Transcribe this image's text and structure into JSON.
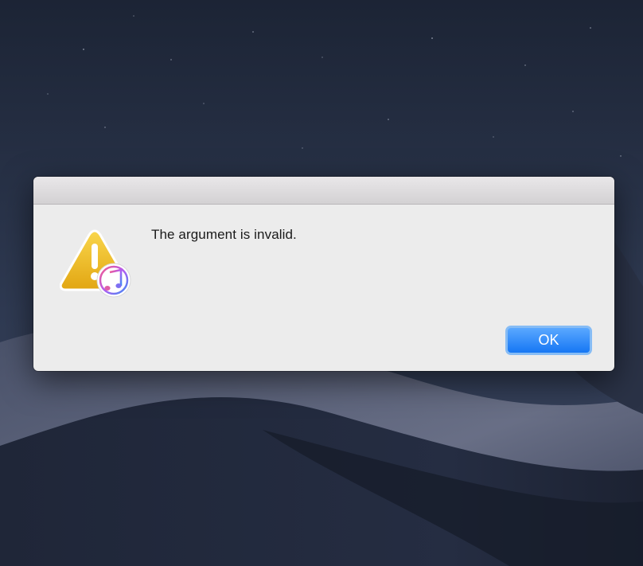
{
  "alert": {
    "message": "The argument is invalid.",
    "ok_label": "OK",
    "icon": "warning-triangle-with-music-badge"
  },
  "colors": {
    "dialog_bg": "#ececec",
    "button_blue": "#1677f4",
    "warning_yellow": "#f2c12e"
  }
}
